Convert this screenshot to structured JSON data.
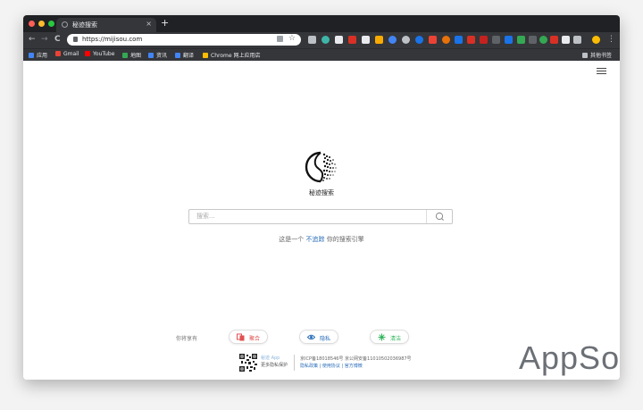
{
  "browser": {
    "tab_title": "秘迹搜索",
    "tab_close": "×",
    "new_tab": "+",
    "url": "https://mijisou.com",
    "nav": {
      "back": "←",
      "forward": "→",
      "reload": "C"
    },
    "bookmarks": [
      "应用",
      "Gmail",
      "YouTube",
      "地图",
      "资讯",
      "翻译",
      "Chrome 网上应用店"
    ],
    "other_bookmarks": "其他书签",
    "colors": {
      "close": "#ff5f57",
      "minimize": "#febc2e",
      "zoom": "#28c840"
    }
  },
  "page": {
    "logo_text": "秘迹搜索",
    "search_placeholder": "搜索...",
    "tagline_prefix": "这是一个",
    "tagline_link": "不追踪",
    "tagline_suffix": "你的搜索引擎",
    "enjoy_label": "你将享有",
    "features": [
      {
        "label": "聚合",
        "icon": "aggregate-icon",
        "color": "#e05050"
      },
      {
        "label": "隐私",
        "icon": "eye-icon",
        "color": "#2a6db8"
      },
      {
        "label": "清洁",
        "icon": "sparkle-icon",
        "color": "#2db45a"
      }
    ],
    "footer": {
      "app_label": "秘迹 App",
      "app_sub": "更多隐私保护",
      "icp": "京ICP备18018546号 京公网安备11010502036987号",
      "links": "隐私政策 | 使用协议 | 官方博微"
    }
  },
  "watermark": "AppSo"
}
